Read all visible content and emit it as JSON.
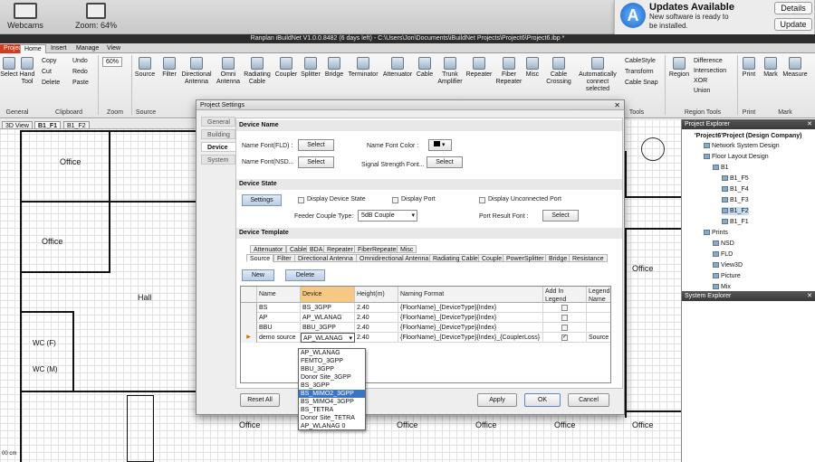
{
  "mac": {
    "webcams": "Webcams",
    "zoom": "Zoom: 64%",
    "notification": {
      "title": "Updates Available",
      "message": "New software is ready to be installed.",
      "details": "Details",
      "update": "Update"
    }
  },
  "window": {
    "title": "Ranplan iBuildNet V1.0.0.8482 (6 days left) - C:\\Users\\Jon\\Documents\\iBuildNet Projects\\Project6\\Project6.ibp *"
  },
  "ribbon_tabs": [
    "Project",
    "Home",
    "Insert",
    "Manage",
    "View"
  ],
  "ribbon": {
    "select": "Select",
    "hand_tool": "Hand Tool",
    "copy": "Copy",
    "cut": "Cut",
    "delete": "Delete",
    "undo": "Undo",
    "redo": "Redo",
    "paste": "Paste",
    "zoom_value": "60%",
    "source": "Source",
    "filter": "Filter",
    "directional_antenna": "Directional Antenna",
    "omni_antenna": "Omni Antenna",
    "radiating_cable": "Radiating Cable",
    "coupler": "Coupler",
    "splitter": "Splitter",
    "bridge": "Bridge",
    "terminator": "Terminator",
    "attenuator": "Attenuator",
    "cable": "Cable",
    "trunk_amplifier": "Trunk Amplifier",
    "repeater": "Repeater",
    "fiber_repeater": "Fiber Repeater",
    "misc": "Misc",
    "cable_crossing": "Cable Crossing",
    "auto_connect": "Automatically connect selected",
    "cable_style": "CableStyle",
    "transform": "Transform",
    "cable_snap": "Cable Snap",
    "region": "Region",
    "difference": "Difference",
    "intersection": "Intersection",
    "xor": "XOR",
    "union": "Union",
    "print": "Print",
    "mark": "Mark",
    "measure": "Measure",
    "groups": {
      "general": "General",
      "clipboard": "Clipboard",
      "zoom": "Zoom",
      "source": "Source",
      "tools": "Tools",
      "region_tools": "Region Tools",
      "print": "Print",
      "mark": "Mark"
    }
  },
  "view_tabs": [
    "3D View",
    "B1_F1",
    "B1_F2"
  ],
  "floorplan": {
    "rooms": [
      "Office",
      "Office",
      "Hall",
      "WC (F)",
      "WC (M)",
      "Office",
      "Office",
      "Office",
      "Office",
      "Office",
      "Office"
    ],
    "scale": "00 cm"
  },
  "project_explorer": {
    "title": "Project Explorer",
    "root": "'Project6'Project (Design Company)",
    "items": [
      "Network System Design",
      "Floor Layout Design",
      "B1",
      "B1_F5",
      "B1_F4",
      "B1_F3",
      "B1_F2",
      "B1_F1",
      "Prints",
      "NSD",
      "FLD",
      "View3D",
      "Picture",
      "Mix"
    ]
  },
  "system_explorer": {
    "title": "System Explorer"
  },
  "dialog": {
    "title": "Project Settings",
    "left_tabs": [
      "General",
      "Building",
      "Device",
      "System"
    ],
    "device_name": {
      "section": "Device Name",
      "name_font_fld": "Name Font(FLD) :",
      "name_font_nsd": "Name Font(NSD...",
      "name_font_color": "Name Font Color :",
      "signal_strength_font": "Signal Strength Font...",
      "select": "Select"
    },
    "device_state": {
      "section": "Device State",
      "settings": "Settings",
      "display_device_state": "Display Device State",
      "display_port": "Display Port",
      "display_unconnected_port": "Display Unconnected Port",
      "feeder_couple_type": "Feeder Couple Type:",
      "feeder_couple_value": "5dB Couple",
      "port_result_font": "Port Result Font :",
      "select": "Select"
    },
    "device_template": {
      "section": "Device Template",
      "tabs_row1": [
        "Attenuator",
        "Cable",
        "BDA",
        "Repeater",
        "FiberRepeater",
        "Misc"
      ],
      "tabs_row2": [
        "Source",
        "Filter",
        "Directional Antenna",
        "Omnidirectional Antenna",
        "Radiating Cable",
        "Couple",
        "PowerSplitter",
        "Bridge",
        "Resistance"
      ],
      "new": "New",
      "delete": "Delete",
      "columns": [
        "Name",
        "Device",
        "Height(m)",
        "Naming Format",
        "Add In Legend",
        "Legend Name"
      ],
      "rows": [
        {
          "name": "BS",
          "device": "BS_3GPP",
          "height": "2.40",
          "format": "{FloorName}_{DeviceType}{Index}",
          "legend_name": ""
        },
        {
          "name": "AP",
          "device": "AP_WLANAG",
          "height": "2.40",
          "format": "{FloorName}_{DeviceType}{Index}",
          "legend_name": ""
        },
        {
          "name": "BBU",
          "device": "BBU_3GPP",
          "height": "2.40",
          "format": "{FloorName}_{DeviceType}{Index}",
          "legend_name": ""
        },
        {
          "name": "demo source",
          "device": "AP_WLANAG",
          "height": "2.40",
          "format": "{FloorName}_{DeviceType}{Index}_{CouplerLoss}",
          "legend_name": "Source"
        }
      ],
      "dropdown_options": [
        "AP_WLANAG",
        "FEMTO_3GPP",
        "BBU_3GPP",
        "Donor Site_3GPP",
        "BS_3GPP",
        "BS_MIMO2_3GPP",
        "BS_MIMO4_3GPP",
        "BS_TETRA",
        "Donor Site_TETRA",
        "AP_WLANAG 0"
      ],
      "dropdown_selected": "BS_MIMO2_3GPP"
    },
    "buttons": {
      "reset_all": "Reset All",
      "apply": "Apply",
      "ok": "OK",
      "cancel": "Cancel"
    }
  },
  "colors": {
    "accent_project_tab": "#d23b1d",
    "selection_blue": "#3a74c6",
    "header_highlight": "#f5c983"
  }
}
